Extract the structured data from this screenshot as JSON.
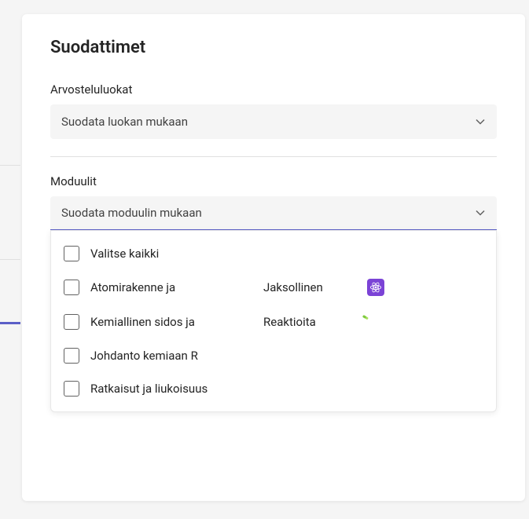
{
  "panel": {
    "title": "Suodattimet"
  },
  "ratingCategories": {
    "label": "Arvosteluluokat",
    "placeholder": "Suodata luokan mukaan"
  },
  "modules": {
    "label": "Moduulit",
    "placeholder": "Suodata moduulin mukaan",
    "options": [
      {
        "primary": "Valitse kaikki",
        "secondary": "",
        "icon": null
      },
      {
        "primary": "Atomirakenne ja",
        "secondary": "Jaksollinen",
        "icon": "atom"
      },
      {
        "primary": "Kemiallinen sidos ja",
        "secondary": "Reaktioita",
        "icon": "tube"
      },
      {
        "primary": "Johdanto kemiaan R",
        "secondary": "",
        "icon": null
      },
      {
        "primary": "Ratkaisut ja liukoisuus",
        "secondary": "",
        "icon": null
      }
    ]
  }
}
